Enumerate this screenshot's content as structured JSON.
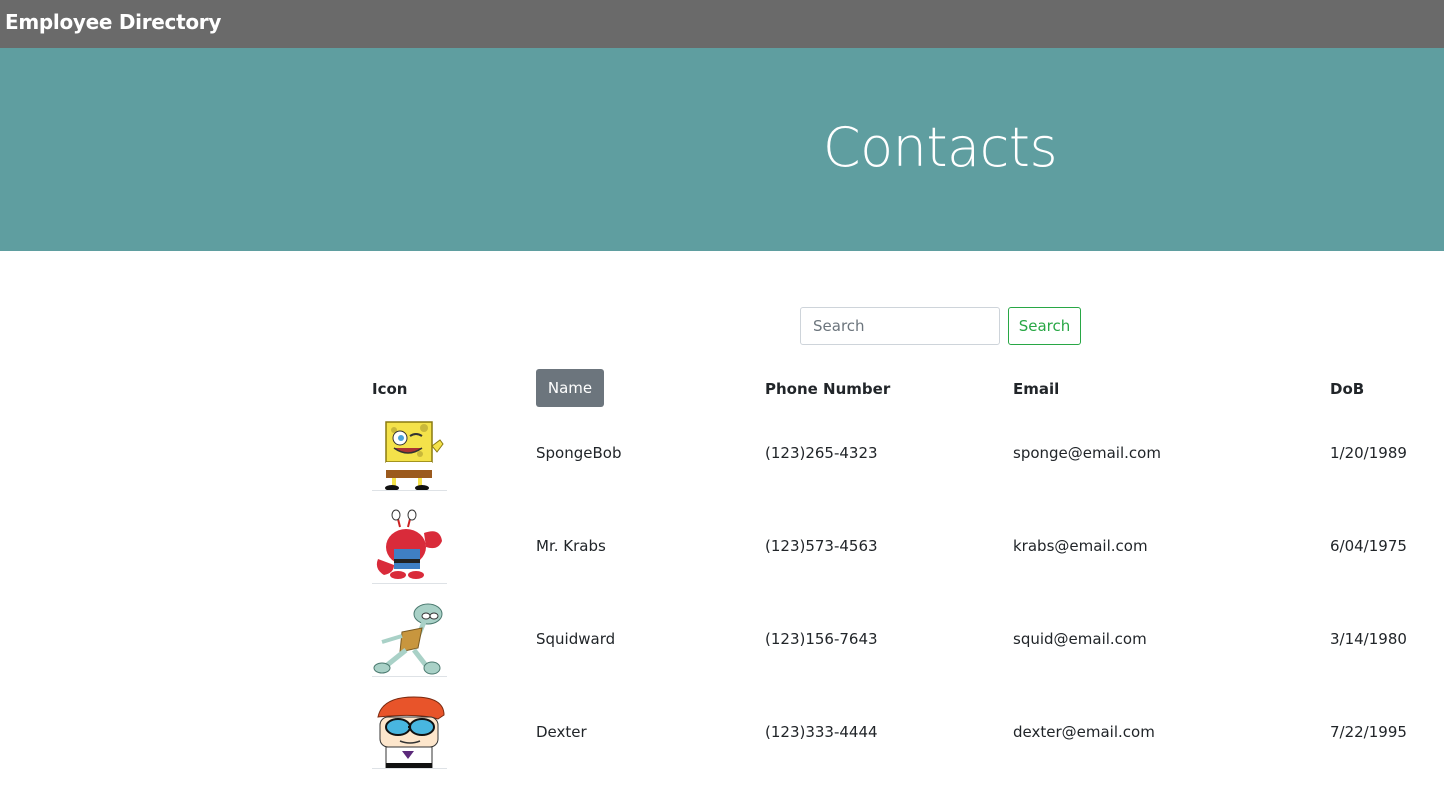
{
  "navbar": {
    "brand": "Employee Directory"
  },
  "jumbotron": {
    "title": "Contacts"
  },
  "search": {
    "placeholder": "Search",
    "button_label": "Search"
  },
  "table": {
    "headers": {
      "icon": "Icon",
      "name": "Name",
      "phone": "Phone Number",
      "email": "Email",
      "dob": "DoB"
    },
    "rows": [
      {
        "icon": "spongebob-avatar",
        "name": "SpongeBob",
        "phone": "(123)265-4323",
        "email": "sponge@email.com",
        "dob": "1/20/1989"
      },
      {
        "icon": "mr-krabs-avatar",
        "name": "Mr. Krabs",
        "phone": "(123)573-4563",
        "email": "krabs@email.com",
        "dob": "6/04/1975"
      },
      {
        "icon": "squidward-avatar",
        "name": "Squidward",
        "phone": "(123)156-7643",
        "email": "squid@email.com",
        "dob": "3/14/1980"
      },
      {
        "icon": "dexter-avatar",
        "name": "Dexter",
        "phone": "(123)333-4444",
        "email": "dexter@email.com",
        "dob": "7/22/1995"
      }
    ]
  },
  "colors": {
    "navbar": "#6a6a6a",
    "jumbotron": "#5f9ea0",
    "search_button": "#28a745",
    "sort_button": "#6c757d"
  }
}
